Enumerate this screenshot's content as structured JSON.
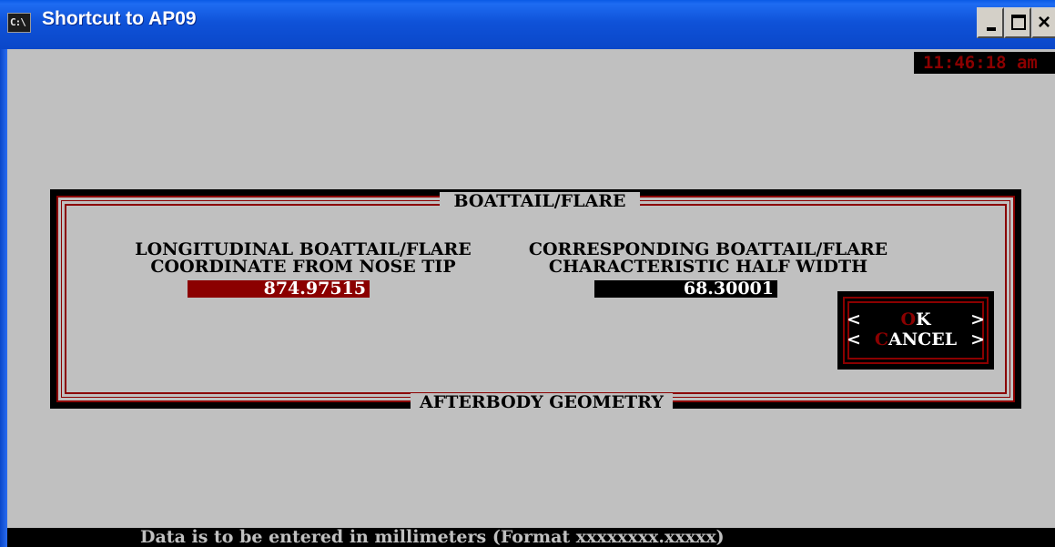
{
  "window": {
    "title": "Shortcut to AP09",
    "icon_text": "C:\\"
  },
  "clock": "11:46:18 am",
  "dialog": {
    "title": "BOATTAIL/FLARE",
    "footer": "AFTERBODY GEOMETRY",
    "left_label_line1": "LONGITUDINAL BOATTAIL/FLARE",
    "left_label_line2": "COORDINATE FROM NOSE TIP",
    "left_value": "874.97515",
    "right_label_line1": "CORRESPONDING BOATTAIL/FLARE",
    "right_label_line2": "CHARACTERISTIC HALF WIDTH",
    "right_value": "68.30001"
  },
  "buttons": {
    "open_bracket": "<",
    "close_bracket": ">",
    "ok_hotkey": "O",
    "ok_rest": "K",
    "cancel_hotkey": "C",
    "cancel_rest": "ANCEL"
  },
  "status": "Data is to be entered in millimeters (Format xxxxxxxx.xxxxx)",
  "colors": {
    "title_bar": "#0a47c9",
    "console_background": "#c0c0c0",
    "accent_red": "#8b0000",
    "black": "#000000",
    "text_white": "#ffffff"
  },
  "icons": [
    "console-app-icon",
    "minimize-icon",
    "maximize-icon",
    "close-icon"
  ]
}
